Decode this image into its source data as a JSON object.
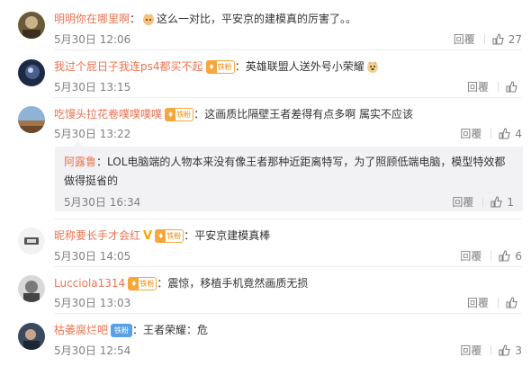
{
  "comments": [
    {
      "user": "明明你在哪里啊",
      "text": "这么一对比，平安京的建模真的厉害了。。",
      "time": "5月30日 12:06",
      "reply": "回覆",
      "likes": "27"
    },
    {
      "user": "我过个屁日子我连ps4都买不起",
      "badge": "铁粉",
      "text": "英雄联盟人送外号小荣耀",
      "time": "5月30日 13:15",
      "reply": "回覆",
      "likes": ""
    },
    {
      "user": "吃馒头拉花卷噗噗噗噗",
      "badge": "铁粉",
      "text": "这画质比隔壁王者差得有点多啊  属实不应该",
      "time": "5月30日 13:22",
      "reply": "回覆",
      "likes": "4"
    },
    {
      "user": "昵称要长手才会红",
      "badge": "铁粉",
      "text": "平安京建模真棒",
      "time": "5月30日 14:05",
      "reply": "回覆",
      "likes": "6"
    },
    {
      "user": "Lucciola1314",
      "badge": "铁粉",
      "text": "震惊，移植手机竟然画质无损",
      "time": "5月30日 13:03",
      "reply": "回覆",
      "likes": ""
    },
    {
      "user": "枯萎腐烂吧",
      "badge": "铁粉",
      "text": "王者荣耀：危",
      "time": "5月30日 12:54",
      "reply": "回覆",
      "likes": "3"
    }
  ],
  "subreply": {
    "user": "阿露鲁",
    "text_line1": "：LOL电脑端的人物本来没有像王者那种近距离特写，为了照顾低端电脑，模型特效都",
    "text_line2": "做得挺省的",
    "time": "5月30日 16:34",
    "reply": "回覆",
    "likes": "1"
  },
  "colors": {
    "username": "#eb7350",
    "meta": "#808080",
    "badge": "#f7a63a",
    "subreply_bg": "#f2f2f5"
  }
}
